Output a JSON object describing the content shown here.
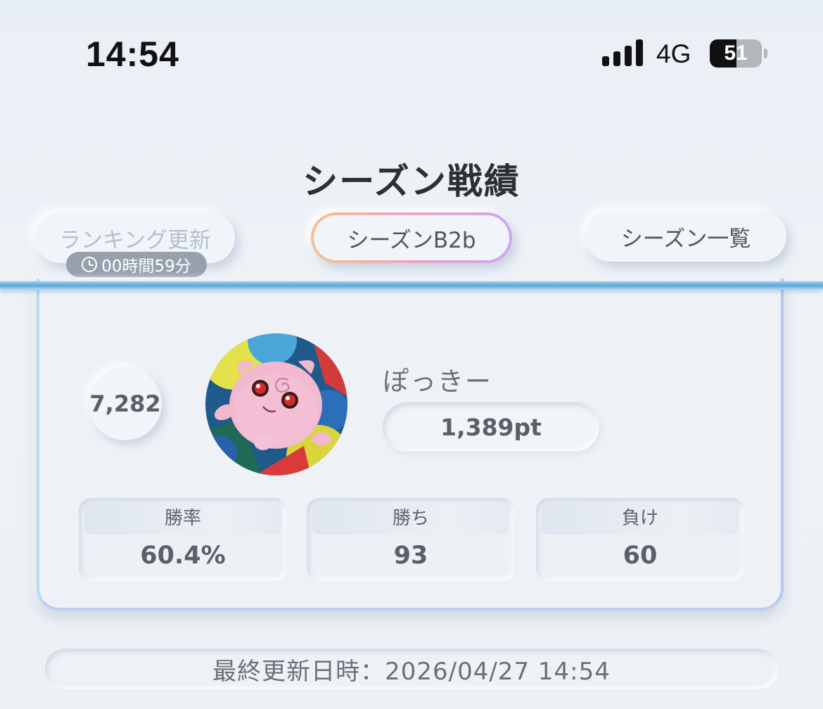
{
  "status_bar": {
    "time": "14:54",
    "network": "4G",
    "battery": "51",
    "battery_level": 0.51
  },
  "header": {
    "title": "シーズン戦績",
    "ranking_button": "ランキング更新",
    "timer": "00時間59分",
    "season_button": "シーズンB2b",
    "season_list_button": "シーズン一覧"
  },
  "player": {
    "rank": "7,282",
    "name": "ぽっきー",
    "points": "1,389pt",
    "avatar_icon": "jigglypuff-like-pink-character"
  },
  "stats": [
    {
      "label": "勝率",
      "value": "60.4%"
    },
    {
      "label": "勝ち",
      "value": "93"
    },
    {
      "label": "負け",
      "value": "60"
    }
  ],
  "footer": {
    "last_updated": "最終更新日時：2026/04/27 14:54"
  },
  "colors": {
    "background": "#eaf0f6",
    "accent_line": "#5aa7d8",
    "title": "#2d2f33",
    "season_border_start": "#f3c28d",
    "season_border_end": "#c9a8f2"
  }
}
